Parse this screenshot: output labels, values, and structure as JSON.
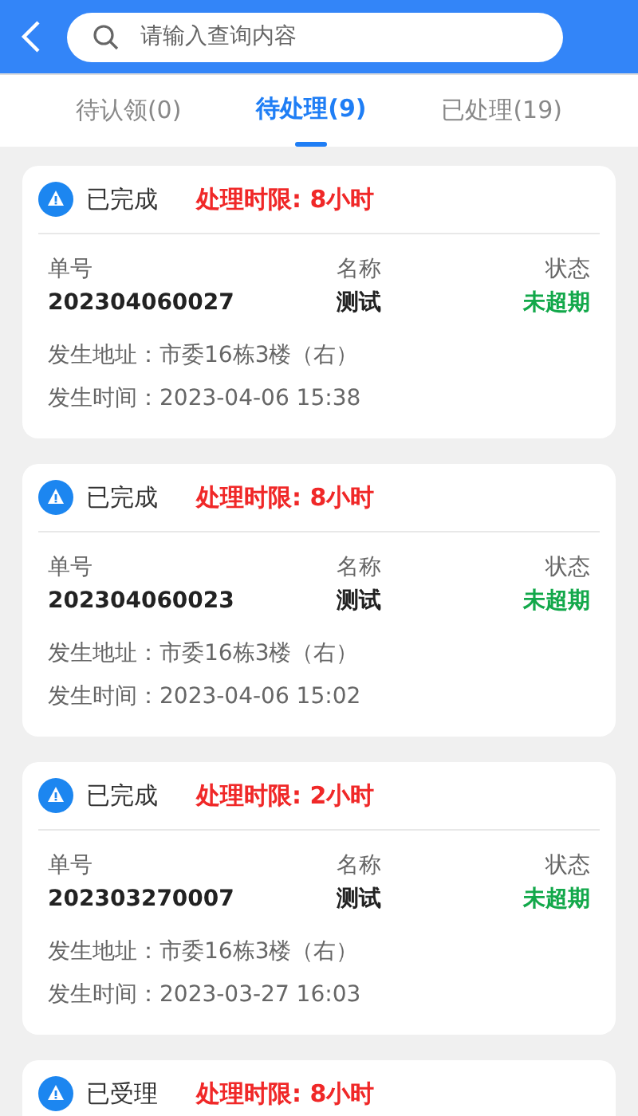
{
  "search": {
    "placeholder": "请输入查询内容"
  },
  "tabs": [
    {
      "label": "待认领(0)",
      "selected": false
    },
    {
      "label": "待处理(9)",
      "selected": true
    },
    {
      "label": "已处理(19)",
      "selected": false
    }
  ],
  "cards": [
    {
      "status": "已完成",
      "deadline": "处理时限: 8小时",
      "number_label": "单号",
      "number": "202304060027",
      "name_label": "名称",
      "name": "测试",
      "state_label": "状态",
      "state": "未超期",
      "address_label": "发生地址：",
      "address": "市委16栋3楼（右）",
      "time_label": "发生时间：",
      "time": "2023-04-06 15:38"
    },
    {
      "status": "已完成",
      "deadline": "处理时限: 8小时",
      "number_label": "单号",
      "number": "202304060023",
      "name_label": "名称",
      "name": "测试",
      "state_label": "状态",
      "state": "未超期",
      "address_label": "发生地址：",
      "address": "市委16栋3楼（右）",
      "time_label": "发生时间：",
      "time": "2023-04-06 15:02"
    },
    {
      "status": "已完成",
      "deadline": "处理时限: 2小时",
      "number_label": "单号",
      "number": "202303270007",
      "name_label": "名称",
      "name": "测试",
      "state_label": "状态",
      "state": "未超期",
      "address_label": "发生地址：",
      "address": "市委16栋3楼（右）",
      "time_label": "发生时间：",
      "time": "2023-03-27 16:03"
    },
    {
      "status": "已受理",
      "deadline": "处理时限: 8小时"
    }
  ]
}
